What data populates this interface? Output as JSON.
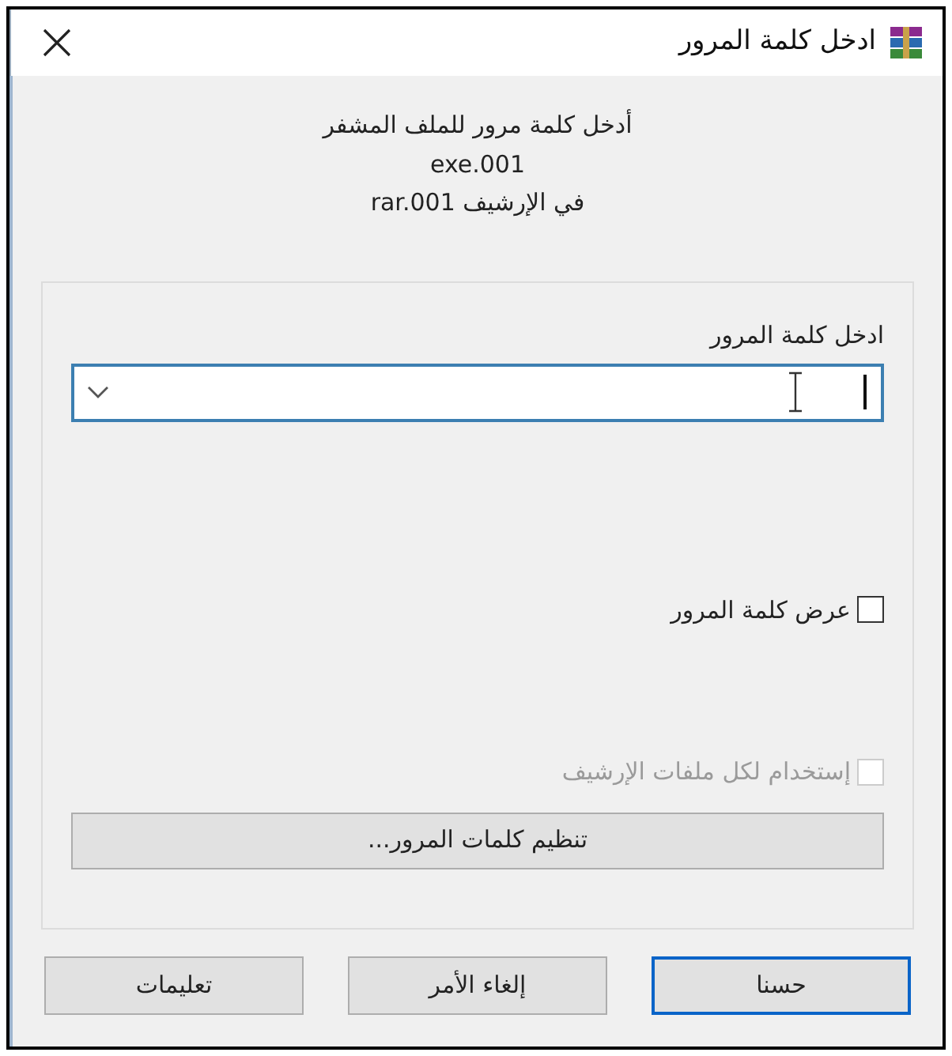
{
  "window": {
    "title": "ادخل كلمة المرور"
  },
  "message": [
    "أدخل كلمة مرور للملف المشفر",
    "exe.001",
    "في الإرشيف rar.001"
  ],
  "password": {
    "label": "ادخل كلمة المرور"
  },
  "checkboxes": [
    {
      "label": "عرض كلمة المرور",
      "checked": false,
      "disabled": false
    },
    {
      "label": "إستخدام لكل ملفات الإرشيف",
      "checked": false,
      "disabled": true
    }
  ],
  "organize_button": "تنظيم كلمات المرور...",
  "buttons": [
    {
      "label": "حسنا",
      "default": true
    },
    {
      "label": "إلغاء الأمر",
      "default": false
    },
    {
      "label": "تعليمات",
      "default": false
    }
  ]
}
